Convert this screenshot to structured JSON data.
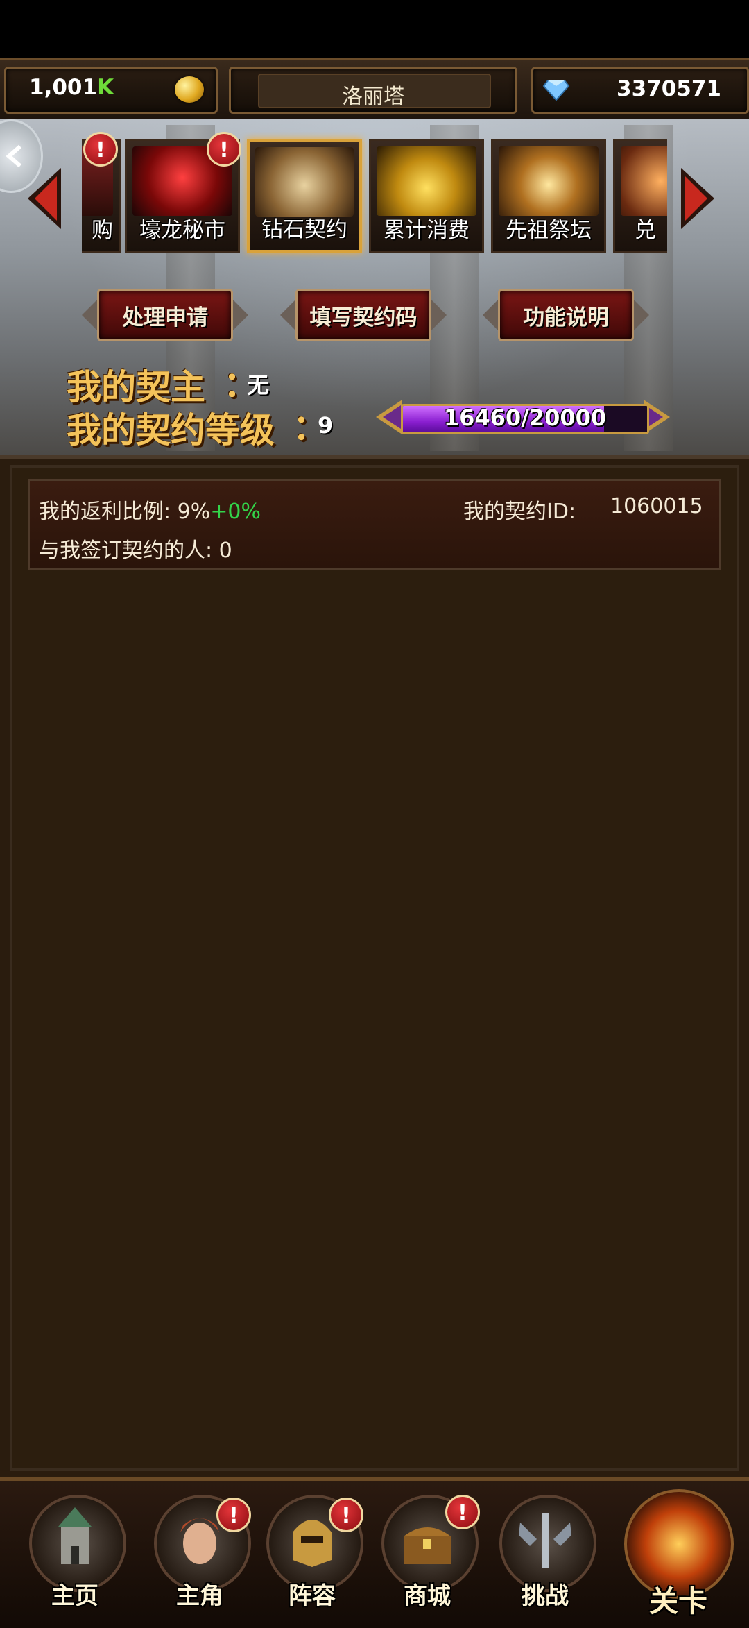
{
  "resources": {
    "gold_amount": "1,001",
    "gold_suffix": "K",
    "character_name": "洛丽塔",
    "gems": "3370571"
  },
  "tabs": [
    {
      "label": "购",
      "alert": "!"
    },
    {
      "label": "壕龙秘市",
      "alert": "!"
    },
    {
      "label": "钻石契约",
      "active": true
    },
    {
      "label": "累计消费"
    },
    {
      "label": "先祖祭坛"
    },
    {
      "label": "兑"
    }
  ],
  "actions": {
    "handle_requests": "处理申请",
    "enter_code": "填写契约码",
    "help": "功能说明"
  },
  "contract": {
    "owner_label": "我的契主",
    "colon": "：",
    "owner_value": "无",
    "level_label": "我的契约等级",
    "level_value": "9",
    "progress_text": "16460/20000",
    "progress_fraction": 0.823
  },
  "info": {
    "rebate_label": "我的返利比例: 9%",
    "rebate_bonus": "+0%",
    "contract_id_label": "我的契约ID:",
    "contract_id_value": "1060015",
    "signed_label": "与我签订契约的人: 0"
  },
  "nav": [
    {
      "label": "主页"
    },
    {
      "label": "主角",
      "alert": "!"
    },
    {
      "label": "阵容",
      "alert": "!"
    },
    {
      "label": "商城",
      "alert": "!"
    },
    {
      "label": "挑战"
    },
    {
      "label": "关卡"
    }
  ]
}
